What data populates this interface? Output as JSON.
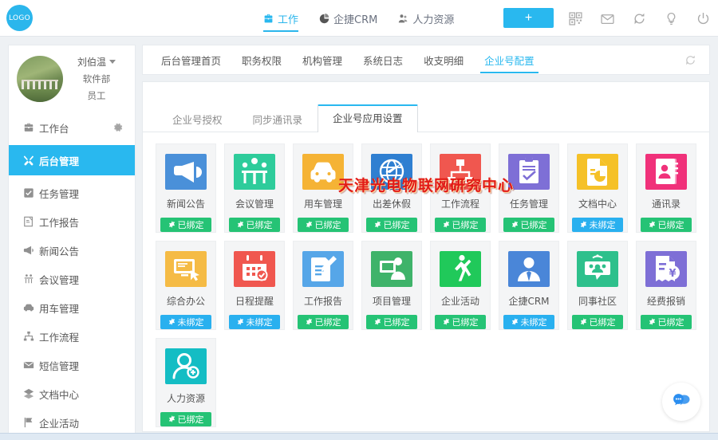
{
  "topbar": {
    "logo_text": "LOGO",
    "nav": [
      {
        "label": "工作",
        "icon": "briefcase-icon",
        "active": true
      },
      {
        "label": "企捷CRM",
        "icon": "pie-chart-icon",
        "active": false
      },
      {
        "label": "人力资源",
        "icon": "people-icon",
        "active": false
      }
    ],
    "add_button_label": "+",
    "icons": [
      "qrcode-icon",
      "mail-icon",
      "refresh-icon",
      "bulb-icon",
      "power-icon"
    ]
  },
  "sidebar": {
    "user": {
      "name": "刘伯温",
      "department": "软件部",
      "role": "员工"
    },
    "items": [
      {
        "label": "工作台",
        "icon": "workbench-icon",
        "active": false,
        "has_gear": true
      },
      {
        "label": "后台管理",
        "icon": "tools-icon",
        "active": true,
        "has_gear": false
      },
      {
        "label": "任务管理",
        "icon": "check-square-icon",
        "active": false,
        "has_gear": false
      },
      {
        "label": "工作报告",
        "icon": "report-icon",
        "active": false,
        "has_gear": false
      },
      {
        "label": "新闻公告",
        "icon": "megaphone-icon",
        "active": false,
        "has_gear": false
      },
      {
        "label": "会议管理",
        "icon": "meeting-icon",
        "active": false,
        "has_gear": false
      },
      {
        "label": "用车管理",
        "icon": "car-icon",
        "active": false,
        "has_gear": false
      },
      {
        "label": "工作流程",
        "icon": "sitemap-icon",
        "active": false,
        "has_gear": false
      },
      {
        "label": "短信管理",
        "icon": "envelope-icon",
        "active": false,
        "has_gear": false
      },
      {
        "label": "文档中心",
        "icon": "document-icon",
        "active": false,
        "has_gear": false
      },
      {
        "label": "企业活动",
        "icon": "flag-icon",
        "active": false,
        "has_gear": false
      }
    ]
  },
  "main": {
    "tabs": [
      {
        "label": "后台管理首页",
        "active": false
      },
      {
        "label": "职务权限",
        "active": false
      },
      {
        "label": "机构管理",
        "active": false
      },
      {
        "label": "系统日志",
        "active": false
      },
      {
        "label": "收支明细",
        "active": false
      },
      {
        "label": "企业号配置",
        "active": true
      }
    ],
    "refresh_icon": "refresh-icon",
    "subtabs": [
      {
        "label": "企业号授权",
        "active": false
      },
      {
        "label": "同步通讯录",
        "active": false
      },
      {
        "label": "企业号应用设置",
        "active": true
      }
    ],
    "watermark": "天津光电物联网研究中心",
    "bound_label": "已绑定",
    "unbound_label": "未绑定",
    "apps": [
      {
        "label": "新闻公告",
        "icon": "megaphone-icon",
        "color": "#4a90d9",
        "status": "bound"
      },
      {
        "label": "会议管理",
        "icon": "meeting-icon",
        "color": "#2ecc9b",
        "status": "bound"
      },
      {
        "label": "用车管理",
        "icon": "car-icon",
        "color": "#f5b335",
        "status": "bound"
      },
      {
        "label": "出差休假",
        "icon": "globe-plane-icon",
        "color": "#2f7fd1",
        "status": "bound"
      },
      {
        "label": "工作流程",
        "icon": "sitemap-icon",
        "color": "#f0574f",
        "status": "bound"
      },
      {
        "label": "任务管理",
        "icon": "clipboard-check-icon",
        "color": "#7e6fd6",
        "status": "bound"
      },
      {
        "label": "文档中心",
        "icon": "document-chart-icon",
        "color": "#f5c128",
        "status": "unbound"
      },
      {
        "label": "通讯录",
        "icon": "address-book-icon",
        "color": "#f0317a",
        "status": "bound"
      },
      {
        "label": "综合办公",
        "icon": "monitor-mouse-icon",
        "color": "#f5bb45",
        "status": "unbound"
      },
      {
        "label": "日程提醒",
        "icon": "calendar-check-icon",
        "color": "#f0574f",
        "status": "unbound"
      },
      {
        "label": "工作报告",
        "icon": "report-pen-icon",
        "color": "#56a6e8",
        "status": "bound"
      },
      {
        "label": "项目管理",
        "icon": "presenter-icon",
        "color": "#3fb36a",
        "status": "bound"
      },
      {
        "label": "企业活动",
        "icon": "golf-icon",
        "color": "#20c95a",
        "status": "bound"
      },
      {
        "label": "企捷CRM",
        "icon": "user-tie-icon",
        "color": "#4a86d8",
        "status": "unbound"
      },
      {
        "label": "同事社区",
        "icon": "community-icon",
        "color": "#2ec08c",
        "status": "bound"
      },
      {
        "label": "经费报销",
        "icon": "receipt-yuan-icon",
        "color": "#7e6fd6",
        "status": "bound"
      },
      {
        "label": "人力资源",
        "icon": "user-add-icon",
        "color": "#14bdc4",
        "status": "bound"
      }
    ],
    "chat_fab_icon": "chat-bubble-icon"
  },
  "taskbar": {
    "left_text": "",
    "right_text": ""
  }
}
